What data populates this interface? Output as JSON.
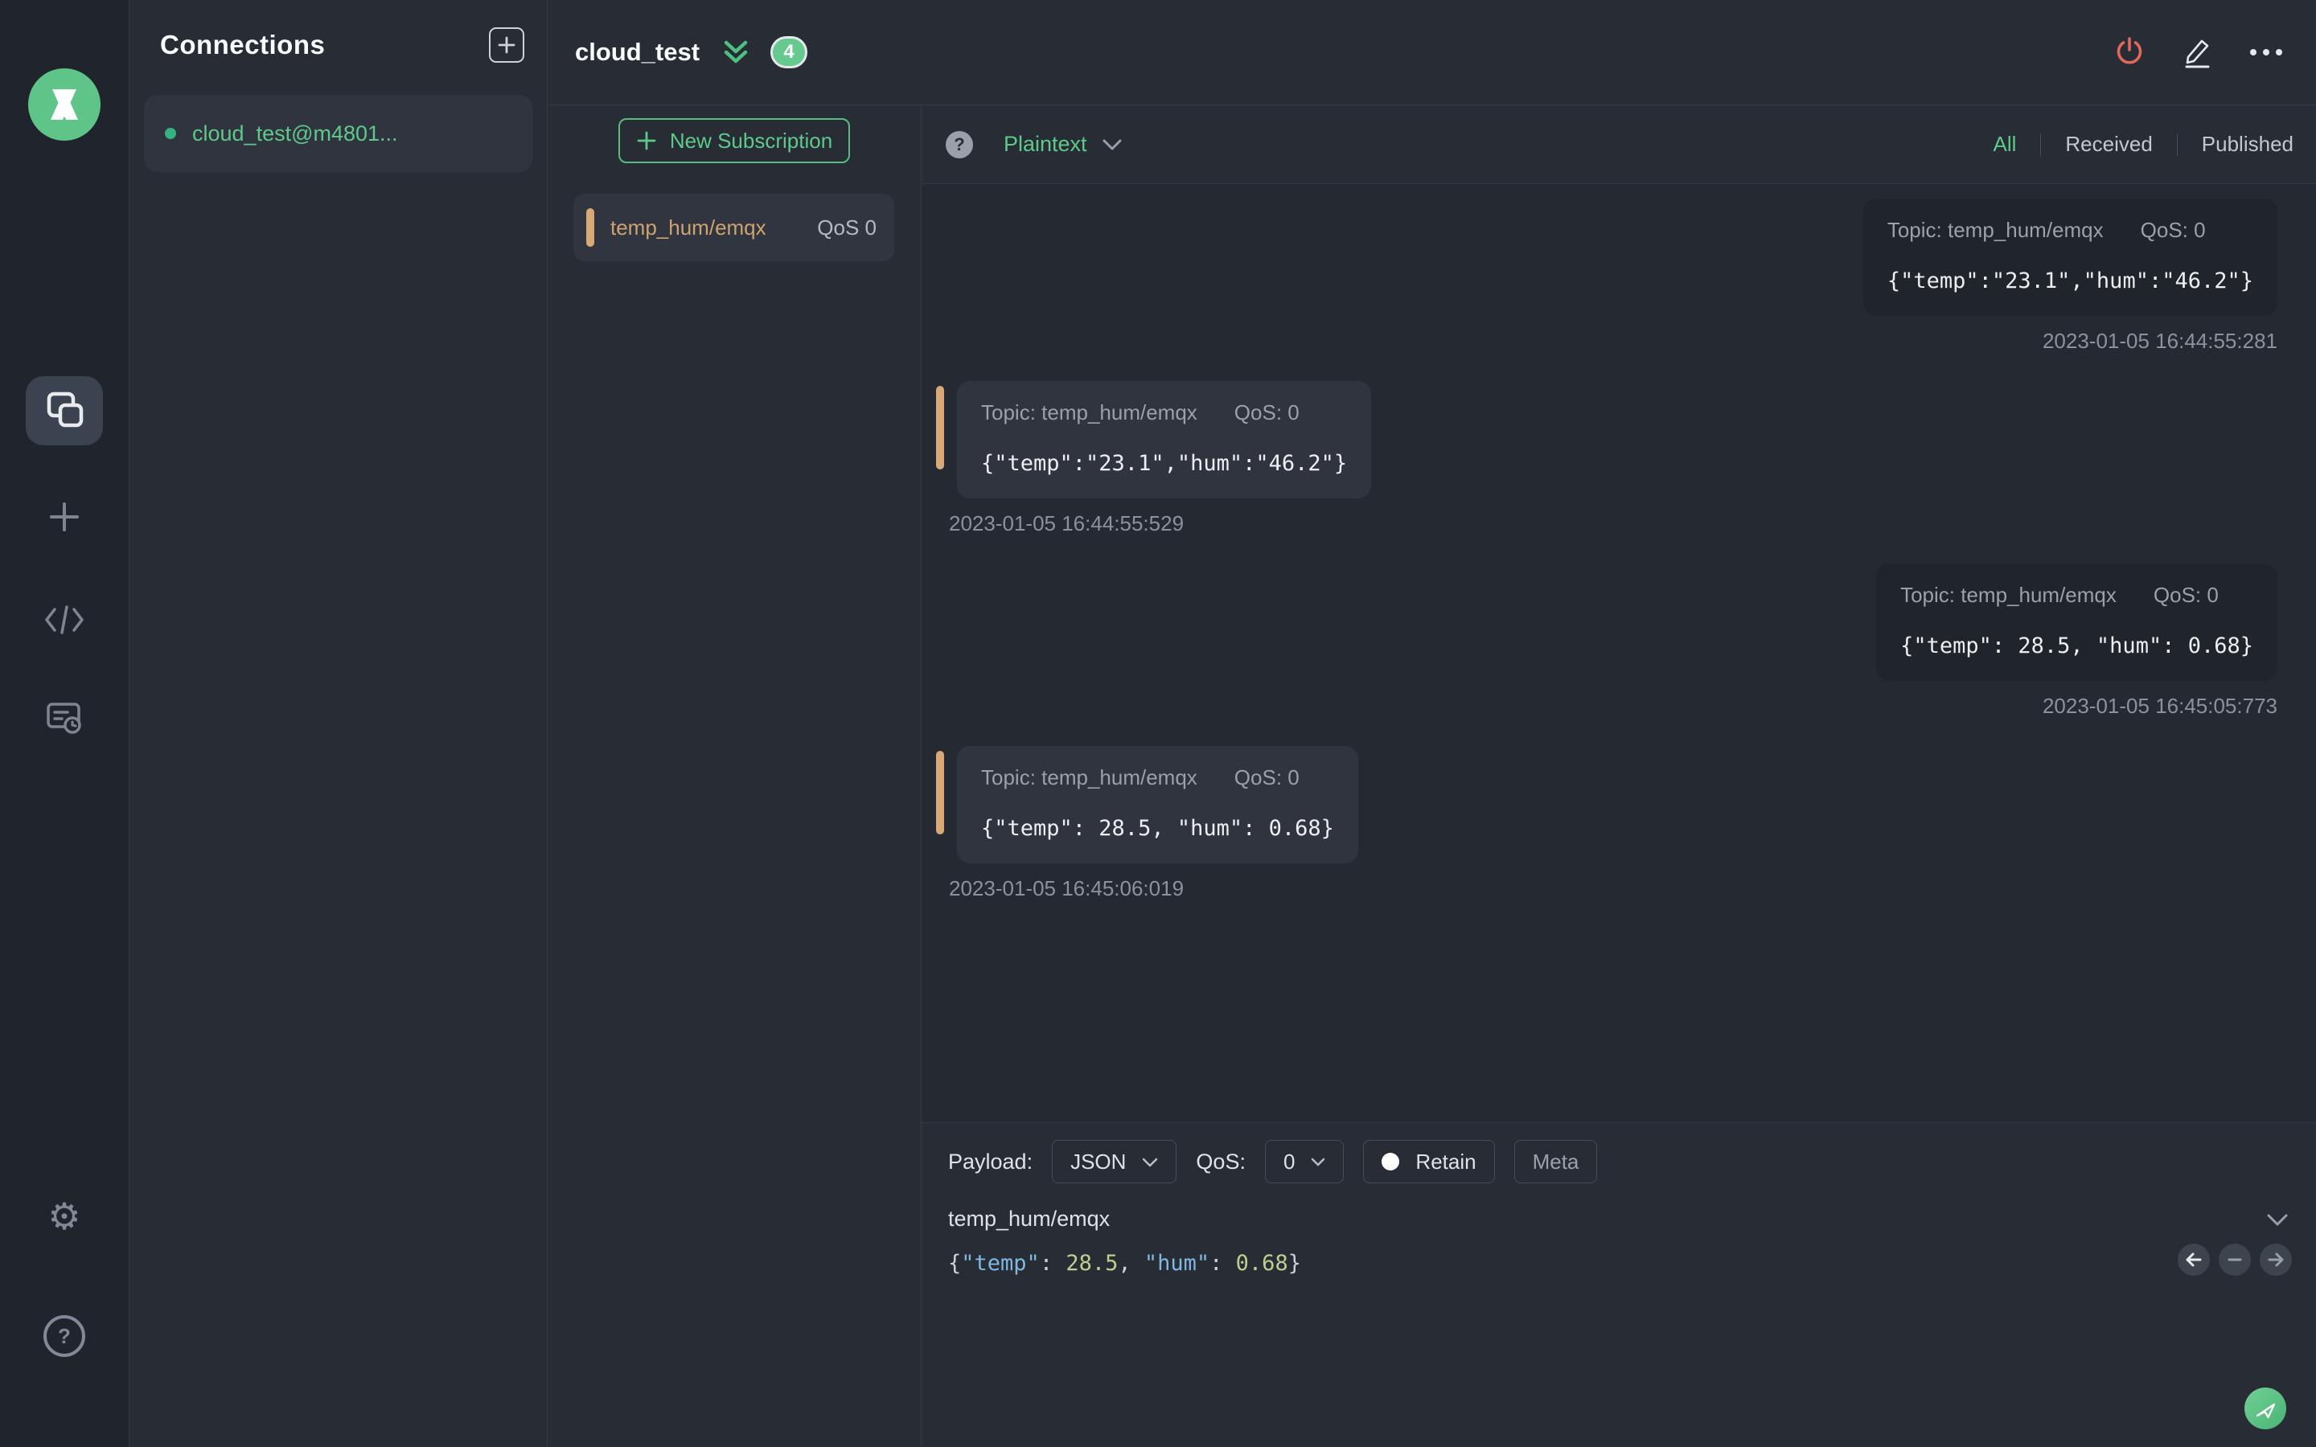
{
  "colors": {
    "accent_green": "#5fc98a",
    "badge_green": "#66c98f",
    "topic_orange": "#d8a977",
    "power_red": "#e0685c",
    "editor_key_blue": "#7fb9e2",
    "editor_number_green": "#bccf90"
  },
  "icons": {
    "help_glyph": "?",
    "gear_glyph": "⚙"
  },
  "sidebar": {
    "items": [
      {
        "name": "connections",
        "active": true
      },
      {
        "name": "new-connection",
        "active": false
      },
      {
        "name": "script",
        "active": false
      },
      {
        "name": "log",
        "active": false
      }
    ],
    "footer": [
      {
        "name": "settings"
      },
      {
        "name": "help"
      }
    ]
  },
  "connections": {
    "title": "Connections",
    "items": [
      {
        "label": "cloud_test@m4801...",
        "connected": true
      }
    ]
  },
  "header": {
    "title": "cloud_test",
    "unread_badge": "4"
  },
  "subscriptions": {
    "new_button_label": "New Subscription",
    "items": [
      {
        "topic": "temp_hum/emqx",
        "qos": "QoS 0"
      }
    ]
  },
  "messages": {
    "format": "Plaintext",
    "filters": {
      "all": "All",
      "received": "Received",
      "published": "Published"
    },
    "active_filter": "All",
    "items": [
      {
        "type": "published",
        "topic": "Topic: temp_hum/emqx",
        "qos": "QoS: 0",
        "payload": "{\"temp\":\"23.1\",\"hum\":\"46.2\"}",
        "time": "2023-01-05 16:44:55:281"
      },
      {
        "type": "received",
        "topic": "Topic: temp_hum/emqx",
        "qos": "QoS: 0",
        "payload": "{\"temp\":\"23.1\",\"hum\":\"46.2\"}",
        "time": "2023-01-05 16:44:55:529"
      },
      {
        "type": "published",
        "topic": "Topic: temp_hum/emqx",
        "qos": "QoS: 0",
        "payload": "{\"temp\": 28.5, \"hum\": 0.68}",
        "time": "2023-01-05 16:45:05:773"
      },
      {
        "type": "received",
        "topic": "Topic: temp_hum/emqx",
        "qos": "QoS: 0",
        "payload": "{\"temp\": 28.5, \"hum\": 0.68}",
        "time": "2023-01-05 16:45:06:019"
      }
    ]
  },
  "publish": {
    "payload_label": "Payload:",
    "format": "JSON",
    "qos_label": "QoS:",
    "qos": "0",
    "retain_label": "Retain",
    "meta_label": "Meta",
    "topic": "temp_hum/emqx",
    "editor_segments": [
      {
        "text": "{",
        "type": "punct"
      },
      {
        "text": "\"temp\"",
        "type": "key"
      },
      {
        "text": ": ",
        "type": "punct"
      },
      {
        "text": "28.5",
        "type": "number"
      },
      {
        "text": ", ",
        "type": "punct"
      },
      {
        "text": "\"hum\"",
        "type": "key"
      },
      {
        "text": ": ",
        "type": "punct"
      },
      {
        "text": "0.68",
        "type": "number"
      },
      {
        "text": "}",
        "type": "punct"
      }
    ]
  }
}
